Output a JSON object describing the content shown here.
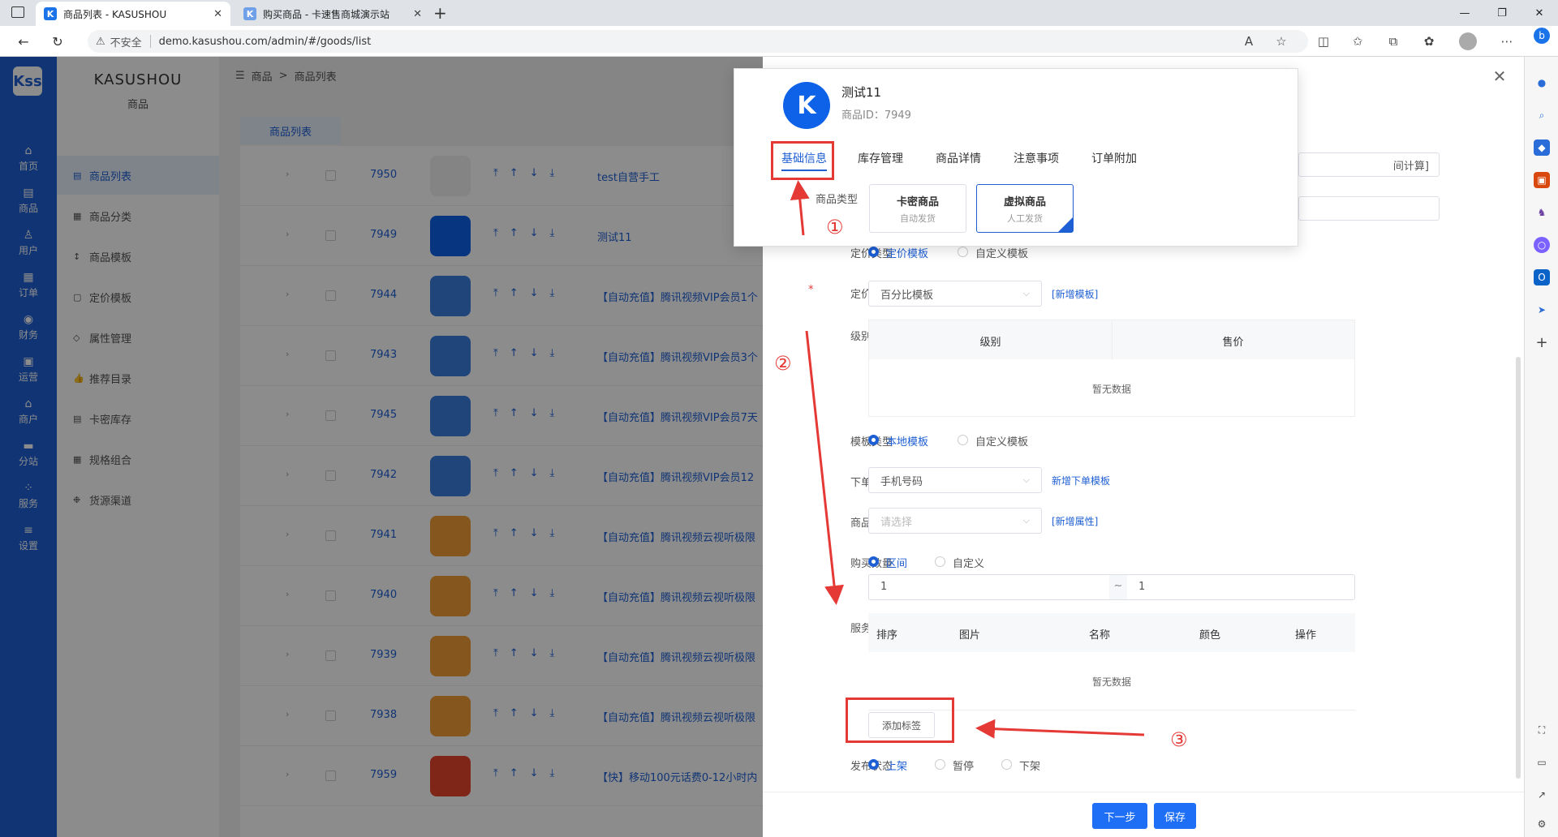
{
  "browser": {
    "tabs": [
      {
        "title": "商品列表 - KASUSHOU",
        "favicon": "K"
      },
      {
        "title": "购买商品 - 卡速售商城演示站",
        "favicon": "K"
      }
    ],
    "security_label": "不安全",
    "url": "demo.kasushou.com/admin/#/goods/list"
  },
  "rail": {
    "logo": "Kss",
    "items": [
      {
        "label": "首页",
        "icon": "home-icon"
      },
      {
        "label": "商品",
        "icon": "goods-icon"
      },
      {
        "label": "用户",
        "icon": "user-icon"
      },
      {
        "label": "订单",
        "icon": "order-icon"
      },
      {
        "label": "财务",
        "icon": "finance-icon"
      },
      {
        "label": "运营",
        "icon": "operation-icon"
      },
      {
        "label": "商户",
        "icon": "merchant-icon"
      },
      {
        "label": "分站",
        "icon": "substation-icon"
      },
      {
        "label": "服务",
        "icon": "service-icon"
      },
      {
        "label": "设置",
        "icon": "settings-icon"
      }
    ]
  },
  "submenu": {
    "brand": "KASUSHOU",
    "section": "商品",
    "items": [
      "商品列表",
      "商品分类",
      "商品模板",
      "定价模板",
      "属性管理",
      "推荐目录",
      "卡密库存",
      "规格组合",
      "货源渠道"
    ]
  },
  "breadcrumb": {
    "root": "商品",
    "separator": ">",
    "current": "商品列表"
  },
  "page_tab": "商品列表",
  "goods_rows": [
    {
      "id": "7950",
      "name": "test自营手工"
    },
    {
      "id": "7949",
      "name": "测试11"
    },
    {
      "id": "7944",
      "name": "【自动充值】腾讯视频VIP会员1个"
    },
    {
      "id": "7943",
      "name": "【自动充值】腾讯视频VIP会员3个"
    },
    {
      "id": "7945",
      "name": "【自动充值】腾讯视频VIP会员7天"
    },
    {
      "id": "7942",
      "name": "【自动充值】腾讯视频VIP会员12"
    },
    {
      "id": "7941",
      "name": "【自动充值】腾讯视频云视听极限"
    },
    {
      "id": "7940",
      "name": "【自动充值】腾讯视频云视听极限"
    },
    {
      "id": "7939",
      "name": "【自动充值】腾讯视频云视听极限"
    },
    {
      "id": "7938",
      "name": "【自动充值】腾讯视频云视听极限"
    },
    {
      "id": "7959",
      "name": "【快】移动100元话费0-12小时内"
    }
  ],
  "card": {
    "product_name": "测试11",
    "product_id_label": "商品ID：7949",
    "tabs": [
      "基础信息",
      "库存管理",
      "商品详情",
      "注意事项",
      "订单附加"
    ],
    "product_type_label": "商品类型",
    "types": [
      {
        "title": "卡密商品",
        "sub": "自动发货"
      },
      {
        "title": "虚拟商品",
        "sub": "人工发货"
      }
    ]
  },
  "form": {
    "bg_fragment": "间计算]",
    "pricing_type_label": "定价类型",
    "pricing_type_options": [
      "定价模板",
      "自定义模板"
    ],
    "pricing_template_label": "定价模板",
    "pricing_template_value": "百分比模板",
    "pricing_template_link": "[新增模板]",
    "level_price_label": "级别价格",
    "level_price_cols": [
      "级别",
      "售价"
    ],
    "empty_text": "暂无数据",
    "template_type_label": "模板类型",
    "template_type_options": [
      "本地模板",
      "自定义模板"
    ],
    "order_template_label": "下单模板",
    "order_template_value": "手机号码",
    "order_template_link": "新增下单模板",
    "attr_label": "商品属性",
    "attr_placeholder": "请选择",
    "attr_link": "[新增属性]",
    "qty_label": "购买数量",
    "qty_options": [
      "区间",
      "自定义"
    ],
    "qty_min": "1",
    "qty_sep": "~",
    "qty_max": "1",
    "service_tag_label": "服务标签",
    "service_tag_cols": [
      "排序",
      "图片",
      "名称",
      "颜色",
      "操作"
    ],
    "add_tag_button": "添加标签",
    "publish_label": "发布状态",
    "publish_options": [
      "上架",
      "暂停",
      "下架"
    ],
    "next_button": "下一步",
    "save_button": "保存"
  },
  "annotations": {
    "step1": "①",
    "step2": "②",
    "step3": "③"
  },
  "colors": {
    "primary": "#1e5fd4",
    "annotation": "#e53935"
  }
}
